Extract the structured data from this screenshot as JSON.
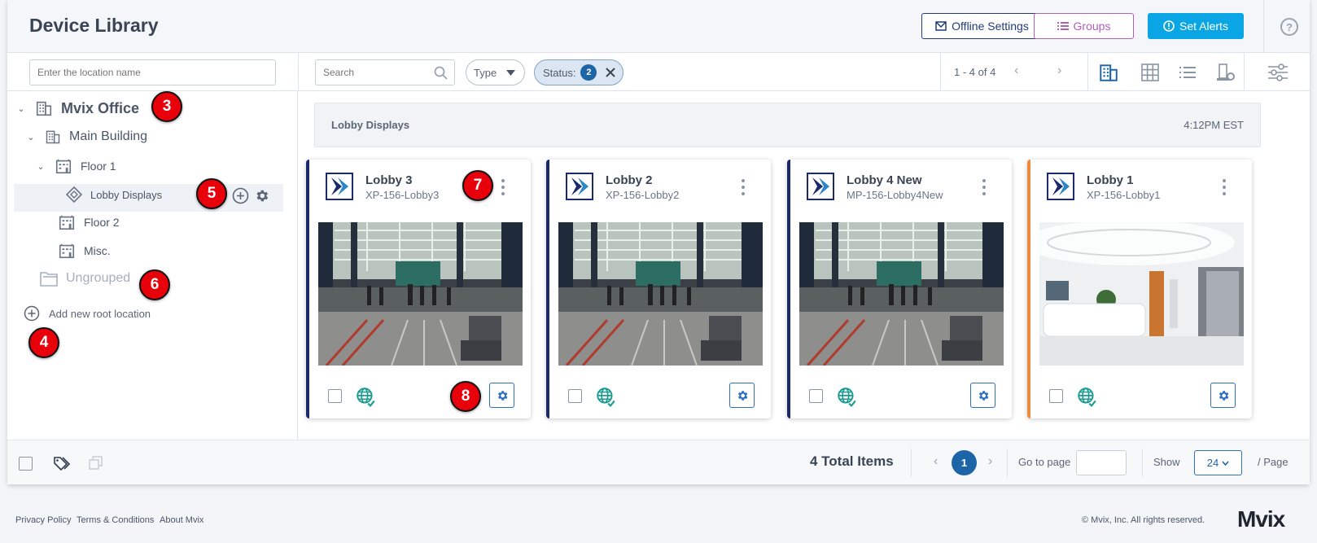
{
  "header": {
    "title": "Device Library",
    "offline_settings": "Offline Settings",
    "groups": "Groups",
    "set_alerts": "Set Alerts",
    "help": "?"
  },
  "toolbar": {
    "location_placeholder": "Enter the location name",
    "search_placeholder": "Search",
    "type_filter": "Type",
    "status_filter": "Status:",
    "status_count": "2",
    "pager": "1 - 4 of 4"
  },
  "tree": {
    "root": "Mvix Office",
    "building": "Main Building",
    "floor1": "Floor 1",
    "selected_group": "Lobby Displays",
    "floor2": "Floor 2",
    "misc": "Misc.",
    "ungrouped": "Ungrouped",
    "add_root": "Add new root location"
  },
  "annotations": [
    "3",
    "4",
    "5",
    "6",
    "7",
    "8"
  ],
  "group": {
    "name": "Lobby Displays",
    "time": "4:12PM EST"
  },
  "devices": [
    {
      "name": "Lobby 3",
      "serial": "XP-156-Lobby3",
      "accent": "#1a2a6c",
      "image": "lobby-hall"
    },
    {
      "name": "Lobby 2",
      "serial": "XP-156-Lobby2",
      "accent": "#1a2a6c",
      "image": "lobby-hall"
    },
    {
      "name": "Lobby 4 New",
      "serial": "MP-156-Lobby4New",
      "accent": "#1a2a6c",
      "image": "lobby-hall"
    },
    {
      "name": "Lobby 1",
      "serial": "XP-156-Lobby1",
      "accent": "#f08a3b",
      "image": "white-reception"
    }
  ],
  "footer_bar": {
    "total": "4 Total Items",
    "current_page": "1",
    "goto_label": "Go to page",
    "show_label": "Show",
    "per_page_value": "24",
    "per_page_label": "/ Page"
  },
  "page_footer": {
    "privacy": "Privacy Policy",
    "terms": "Terms & Conditions",
    "about": "About Mvix",
    "copyright": "© Mvix, Inc. All rights reserved.",
    "brand": "Mvix"
  },
  "colors": {
    "accent_blue": "#1e65a8",
    "alert_blue": "#0aa5e4",
    "groups_purple": "#b25fb8",
    "offline_navy": "#1f3c78",
    "offline_card": "#f08a3b"
  }
}
